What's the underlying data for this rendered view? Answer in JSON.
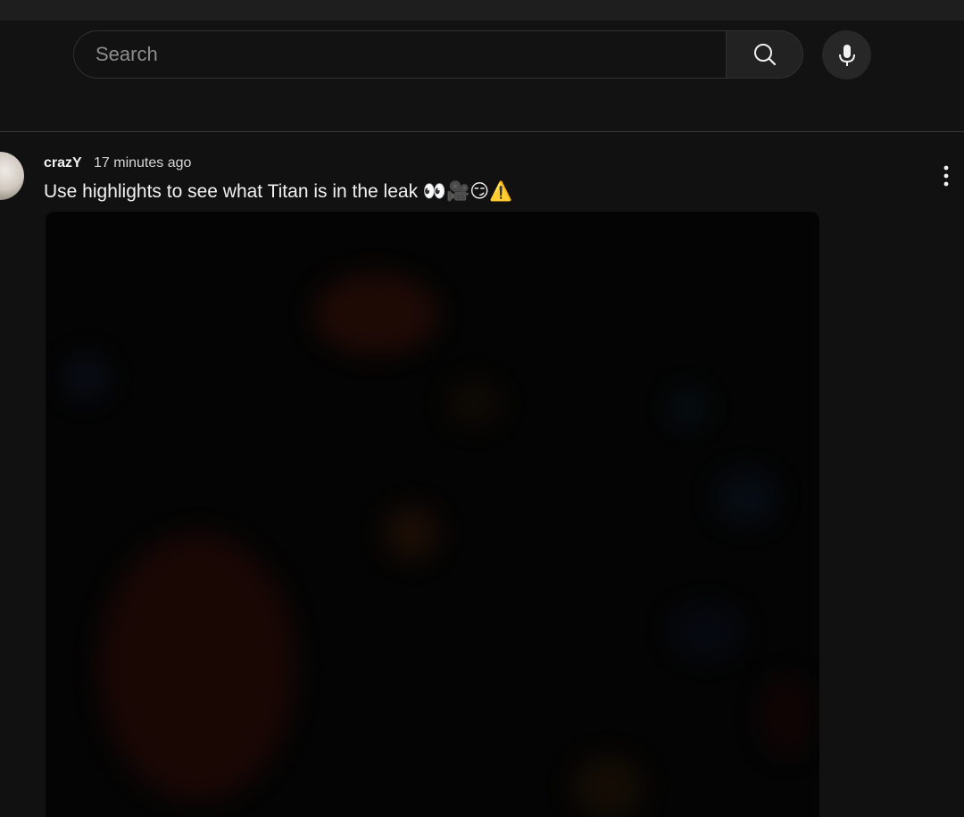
{
  "search": {
    "placeholder": "Search",
    "value": ""
  },
  "icons": {
    "search_button": "search-icon",
    "mic_button": "microphone-icon",
    "more": "vertical-ellipsis-icon"
  },
  "comment": {
    "author": "crazY",
    "timestamp": "17 minutes ago",
    "text": "Use highlights to see what Titan is in the leak 👀🎥😏⚠️"
  },
  "colors": {
    "background": "#111111",
    "text_primary": "#f1f1f1",
    "text_secondary": "#d6d6d6",
    "search_border": "#303030",
    "button_bg": "#222222"
  }
}
